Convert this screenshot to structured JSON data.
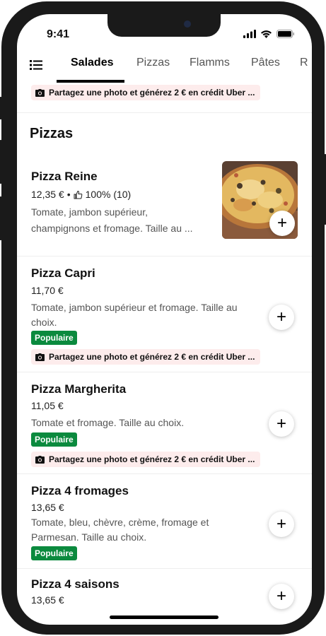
{
  "status_bar": {
    "time": "9:41"
  },
  "tabs": [
    "Salades",
    "Pizzas",
    "Flamms",
    "Pâtes",
    "R"
  ],
  "promo_text": "Partagez une photo et générez 2 € en crédit Uber ...",
  "section": {
    "title": "Pizzas"
  },
  "items": [
    {
      "name": "Pizza Reine",
      "price": "12,35 €",
      "rating": "100% (10)",
      "desc_line1": "Tomate, jambon supérieur,",
      "desc_line2": "champignons et fromage. Taille au ..."
    },
    {
      "name": "Pizza Capri",
      "price": "11,70 €",
      "desc_line1": "Tomate, jambon supérieur et fromage. Taille au",
      "desc_line2": "choix.",
      "badge": "Populaire"
    },
    {
      "name": "Pizza Margherita",
      "price": "11,05 €",
      "desc_line1": "Tomate et fromage. Taille au choix.",
      "badge": "Populaire"
    },
    {
      "name": "Pizza 4 fromages",
      "price": "13,65 €",
      "desc_line1": "Tomate, bleu, chèvre, crème, fromage et",
      "desc_line2": "Parmesan. Taille au choix.",
      "badge": "Populaire"
    },
    {
      "name": "Pizza 4 saisons",
      "price": "13,65 €"
    }
  ],
  "add_label": "+",
  "colors": {
    "badge": "#0b8a3e",
    "promo_bg": "#fdecec"
  }
}
